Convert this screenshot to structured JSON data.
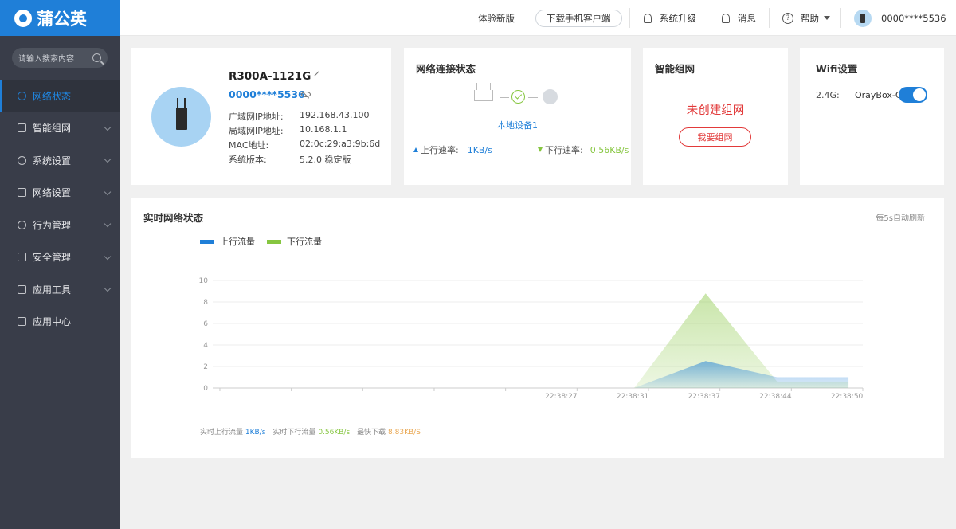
{
  "colors": {
    "brand": "#1f7fd8",
    "upload": "#1f7fd8",
    "download": "#86c640",
    "peak": "#e9a64f",
    "danger": "#e23a3a"
  },
  "brand": {
    "name": "蒲公英"
  },
  "sidebar": {
    "search_placeholder": "请输入搜索内容",
    "items": [
      {
        "label": "网络状态",
        "icon": "network-icon",
        "active": true
      },
      {
        "label": "智能组网",
        "icon": "mesh-icon"
      },
      {
        "label": "系统设置",
        "icon": "gear-icon"
      },
      {
        "label": "网络设置",
        "icon": "doc-icon"
      },
      {
        "label": "行为管理",
        "icon": "eye-icon"
      },
      {
        "label": "安全管理",
        "icon": "shield-icon"
      },
      {
        "label": "应用工具",
        "icon": "toolbox-icon"
      },
      {
        "label": "应用中心",
        "icon": "cube-icon"
      }
    ]
  },
  "header": {
    "new_version": "体验新版",
    "download_client": "下载手机客户端",
    "upgrade": "系统升级",
    "messages": "消息",
    "help": "帮助",
    "user": "0000****5536"
  },
  "device": {
    "name": "R300A-1121G",
    "id": "0000****5536",
    "info": [
      {
        "label": "广域网IP地址:",
        "value": "192.168.43.100"
      },
      {
        "label": "局域网IP地址:",
        "value": "10.168.1.1"
      },
      {
        "label": "MAC地址:",
        "value": "02:0c:29:a3:9b:6d"
      },
      {
        "label": "系统版本:",
        "value": "5.2.0 稳定版"
      }
    ]
  },
  "network": {
    "title": "网络连接状态",
    "local_device": "本地设备1",
    "up_label": "上行速率:",
    "up_value": "1KB/s",
    "down_label": "下行速率:",
    "down_value": "0.56KB/s"
  },
  "mesh": {
    "title": "智能组网",
    "status": "未创建组网",
    "button": "我要组网"
  },
  "wifi": {
    "title": "Wifi设置",
    "band": "2.4G:",
    "ssid": "OrayBox-CA",
    "enabled": true
  },
  "realtime": {
    "title": "实时网络状态",
    "refresh_note": "每5s自动刷新",
    "stats": [
      {
        "label": "实时上行流量",
        "value": "1KB/s"
      },
      {
        "label": "实时下行流量",
        "value": "0.56KB/s"
      },
      {
        "label": "最快下载",
        "value": "8.83KB/S"
      }
    ]
  },
  "chart_data": {
    "type": "area",
    "title": "",
    "xlabel": "",
    "ylabel": "",
    "ylim": [
      0,
      10
    ],
    "yticks": [
      "0",
      "2",
      "4",
      "6",
      "8",
      "10"
    ],
    "x": [
      "22:38:27",
      "22:38:31",
      "22:38:37",
      "22:38:44",
      "22:38:50"
    ],
    "series": [
      {
        "name": "上行流量",
        "color": "#1f7fd8",
        "values": [
          0,
          0,
          2.5,
          1,
          1
        ]
      },
      {
        "name": "下行流量",
        "color": "#86c640",
        "values": [
          0,
          0,
          8.8,
          0.6,
          0.6
        ]
      }
    ],
    "grid": true,
    "legend": "top-left"
  }
}
